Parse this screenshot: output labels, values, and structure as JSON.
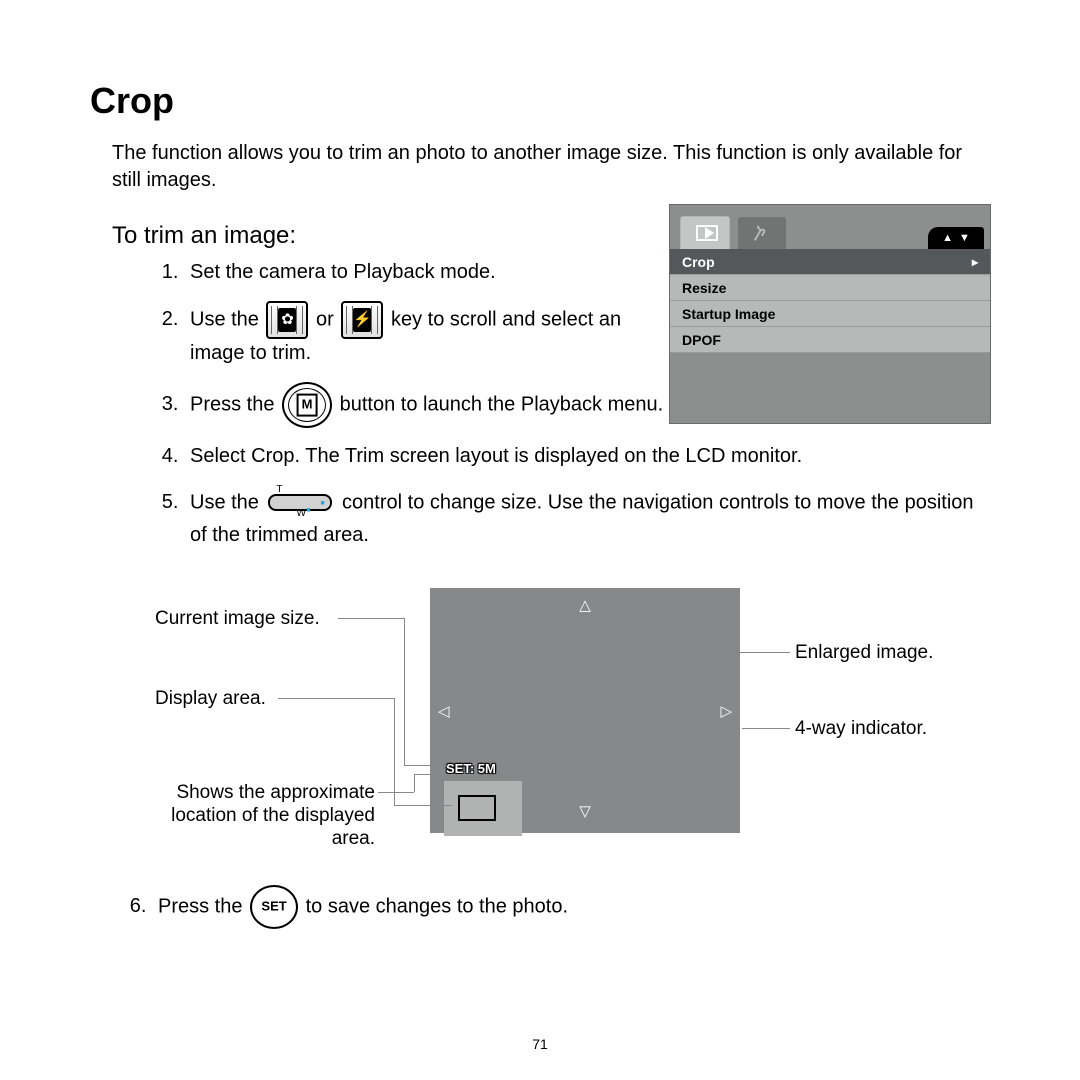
{
  "title": "Crop",
  "intro": "The function allows you to trim an photo to another image size. This function is only available for still images.",
  "subheading": "To trim an image:",
  "steps": {
    "s1": "Set the camera to Playback mode.",
    "s2a": "Use the ",
    "s2b": " or ",
    "s2c": " key to scroll and select an image to trim.",
    "s3a": "Press the ",
    "s3b": " button to launch the Playback menu.",
    "s4": "Select Crop. The Trim screen layout is displayed on the LCD monitor.",
    "s5a": "Use the ",
    "s5b": " control to change size. Use the navigation controls to move the position of the trimmed area.",
    "s6a": "Press the ",
    "s6b": " to save changes to the photo."
  },
  "icons": {
    "flower": "✿",
    "flash": "⚡",
    "menu": "M",
    "set": "SET",
    "zoom_t": "T",
    "zoom_w": "W"
  },
  "menu_shot": {
    "tabs_pager_up": "▲",
    "tabs_pager_down": "▼",
    "rows": [
      {
        "label": "Crop",
        "selected": true,
        "indicator": "▸"
      },
      {
        "label": "Resize",
        "selected": false,
        "indicator": ""
      },
      {
        "label": "Startup Image",
        "selected": false,
        "indicator": ""
      },
      {
        "label": "DPOF",
        "selected": false,
        "indicator": ""
      }
    ]
  },
  "diagram": {
    "set_label": "SET: 5M",
    "labels": {
      "current_size": "Current image size.",
      "display_area": "Display area.",
      "approx_loc_l1": "Shows the approximate",
      "approx_loc_l2": "location of the displayed",
      "approx_loc_l3": "area.",
      "enlarged": "Enlarged image.",
      "fourway": "4-way indicator."
    },
    "arrows": {
      "up": "△",
      "down": "▽",
      "left": "◁",
      "right": "▷"
    }
  },
  "page_number": "71"
}
